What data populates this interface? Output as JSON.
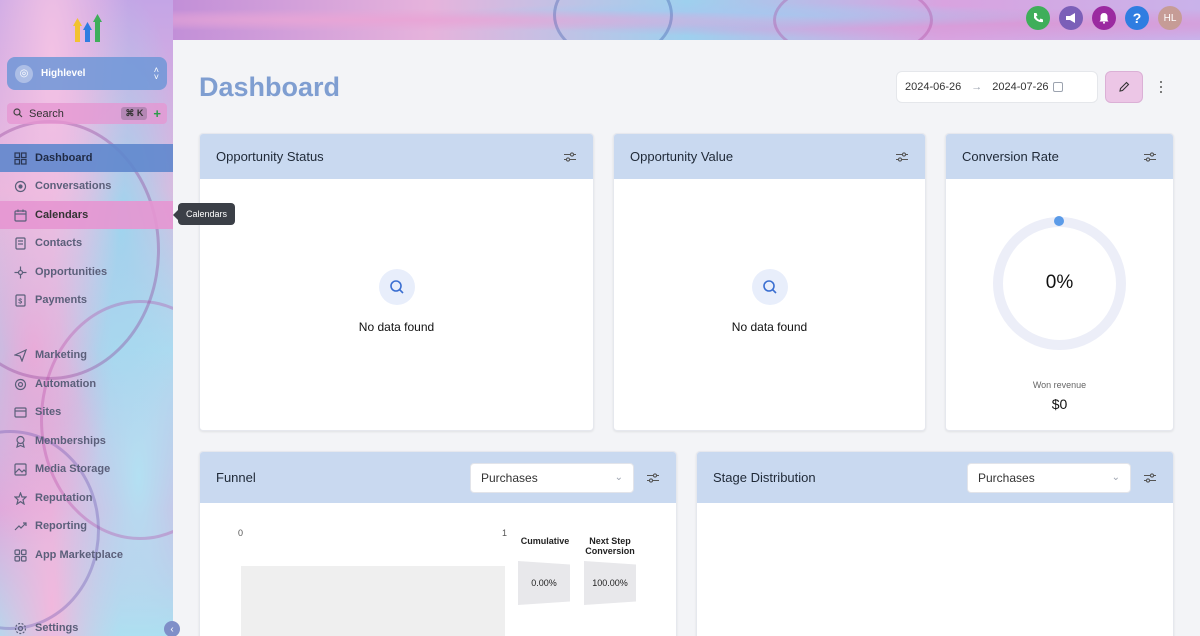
{
  "sidebar": {
    "account_name": "Highlevel",
    "search": {
      "label": "Search",
      "shortcut": "⌘ K",
      "plus": "+"
    },
    "items": [
      {
        "id": "dashboard",
        "label": "Dashboard",
        "icon": "grid-icon"
      },
      {
        "id": "conversations",
        "label": "Conversations",
        "icon": "chat-icon"
      },
      {
        "id": "calendars",
        "label": "Calendars",
        "icon": "calendar-icon"
      },
      {
        "id": "contacts",
        "label": "Contacts",
        "icon": "contacts-icon"
      },
      {
        "id": "opportunities",
        "label": "Opportunities",
        "icon": "opportunities-icon"
      },
      {
        "id": "payments",
        "label": "Payments",
        "icon": "payments-icon"
      },
      {
        "id": "marketing",
        "label": "Marketing",
        "icon": "send-icon"
      },
      {
        "id": "automation",
        "label": "Automation",
        "icon": "automation-icon"
      },
      {
        "id": "sites",
        "label": "Sites",
        "icon": "sites-icon"
      },
      {
        "id": "memberships",
        "label": "Memberships",
        "icon": "memberships-icon"
      },
      {
        "id": "media-storage",
        "label": "Media Storage",
        "icon": "image-icon"
      },
      {
        "id": "reputation",
        "label": "Reputation",
        "icon": "star-icon"
      },
      {
        "id": "reporting",
        "label": "Reporting",
        "icon": "trend-icon"
      },
      {
        "id": "app-marketplace",
        "label": "App Marketplace",
        "icon": "apps-icon"
      },
      {
        "id": "settings",
        "label": "Settings",
        "icon": "gear-icon"
      }
    ],
    "tooltip": "Calendars"
  },
  "header": {
    "avatar_initials": "HL",
    "colors": {
      "phone": "#3fae5a",
      "megaphone": "#7b5fb8",
      "bell": "#9b2aa0",
      "help": "#2f7de1",
      "avatar": "#c69c96"
    }
  },
  "main": {
    "title": "Dashboard",
    "date_start": "2024-06-26",
    "date_end": "2024-07-26",
    "cards": {
      "opportunity_status": {
        "title": "Opportunity Status",
        "empty": "No data found"
      },
      "opportunity_value": {
        "title": "Opportunity Value",
        "empty": "No data found"
      },
      "conversion_rate": {
        "title": "Conversion Rate",
        "rate": "0%",
        "won_label": "Won revenue",
        "won_value": "$0"
      },
      "funnel": {
        "title": "Funnel",
        "select": "Purchases",
        "axis_min": "0",
        "axis_max": "1",
        "cumulative_label": "Cumulative",
        "cumulative_value": "0.00%",
        "next_label": "Next Step Conversion",
        "next_value": "100.00%"
      },
      "stage_distribution": {
        "title": "Stage Distribution",
        "select": "Purchases"
      }
    }
  }
}
